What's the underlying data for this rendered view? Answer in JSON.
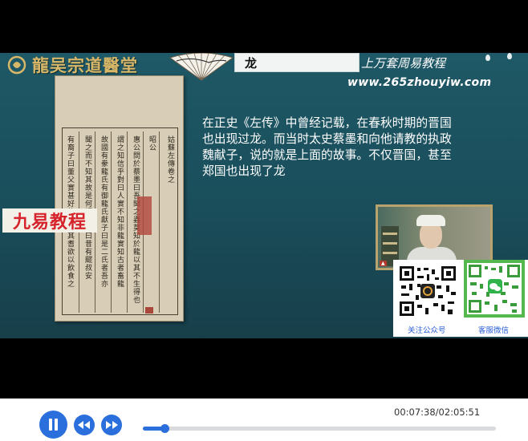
{
  "slide": {
    "brand": "龍吴宗道醫堂",
    "title_box": "龙",
    "tagline": "上万套周易教程",
    "url": "www.265zhouyiw.com",
    "watermark": "九易教程",
    "narration": "在正史《左传》中曾经记载，在春秋时期的晋国也出现过龙。而当时太史蔡墨和向他请教的执政魏献子，说的就是上面的故事。不仅晋国，甚至郑国也出现了龙",
    "book_columns": [
      "姑蘇左傳卷之",
      "昭公",
      "惠公問於蔡墨曰吾聞之蟲莫知於龍以其不生得也",
      "謂之知信乎對曰人實不知非龍實知古者畜龍",
      "故國有豢龍氏有御龍氏獻子曰是二氏者吾亦",
      "聞之而不知其故是何謂也對曰昔有飂叔安",
      "有裔子曰董父實甚好龍能求其耆欲以飲食之"
    ],
    "qr_captions": [
      "关注公众号",
      "客服微信"
    ]
  },
  "controls": {
    "time": "00:07:38/02:05:51",
    "progress": 0.061
  },
  "colors": {
    "accent": "#2a6fdc",
    "watermark_red": "#d6232b",
    "slide_bg": "#1c5260"
  },
  "icons": [
    "pause-icon",
    "rewind-icon",
    "fast-forward-icon",
    "brand-logo-icon"
  ]
}
